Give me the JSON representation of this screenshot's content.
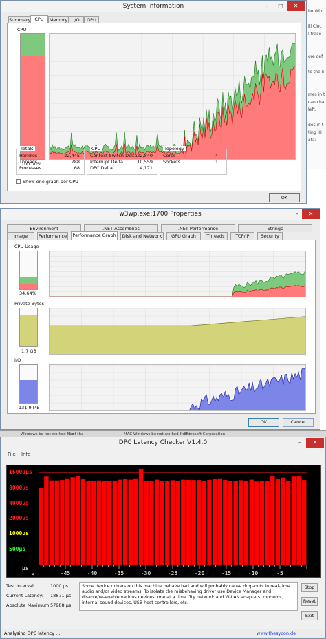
{
  "background_window": {
    "text_lines": [
      "hould c",
      "",
      "ill Cloc",
      "I trace",
      "",
      "",
      "ore def",
      "",
      "to the li",
      "",
      "",
      "mes in t",
      "can cha",
      "left.",
      "",
      "des in t",
      "ting 'H",
      "ata:"
    ],
    "taskbar_items": [
      "Windows be not worked fine",
      "",
      "1 of the",
      "",
      "",
      "MAC Windows be not worked freeti",
      "Microsoft Corporation"
    ]
  },
  "sysinfo": {
    "title": "System Information",
    "tabs": [
      "Summary",
      "CPU",
      "Memory",
      "I/O",
      "GPU"
    ],
    "active_tab": 1,
    "meter_label": "CPU",
    "meter_value": "100.00%",
    "meter_fraction_red": 0.82,
    "meter_fraction_total": 1.0,
    "totals": {
      "title": "Totals",
      "rows": [
        {
          "label": "Handles",
          "value": "22,445"
        },
        {
          "label": "Threads",
          "value": "788"
        },
        {
          "label": "Processes",
          "value": "68"
        }
      ]
    },
    "cpu_group": {
      "title": "CPU",
      "rows": [
        {
          "label": "Context Switch Delta",
          "value": "22,840"
        },
        {
          "label": "Interrupt Delta",
          "value": "10,559"
        },
        {
          "label": "DPC Delta",
          "value": "4,171"
        }
      ]
    },
    "topology": {
      "title": "Topology",
      "rows": [
        {
          "label": "Cores",
          "value": "4"
        },
        {
          "label": "Sockets",
          "value": "1"
        }
      ]
    },
    "checkbox_label": "Show one graph per CPU",
    "ok_label": "OK"
  },
  "w3wp": {
    "title": "w3wp.exe:1700 Properties",
    "tabs_row1": [
      "Environment",
      ".NET Assemblies",
      ".NET Performance",
      "Strings"
    ],
    "tabs_row2": [
      "Image",
      "Performance",
      "Performance Graph",
      "Disk and Network",
      "GPU Graph",
      "Threads",
      "TCP/IP",
      "Security"
    ],
    "active_tab_row2": 2,
    "cpu": {
      "label": "CPU Usage",
      "value": "34.64%",
      "fraction_red": 0.15,
      "fraction_total": 0.32
    },
    "private_bytes": {
      "label": "Private Bytes",
      "value": "1.7 GB",
      "fraction": 0.82
    },
    "io": {
      "label": "I/O",
      "value": "131.9 MB",
      "fraction": 0.6
    },
    "ok_label": "OK",
    "cancel_label": "Cancel"
  },
  "dpc": {
    "title": "DPC Latency Checker V1.4.0",
    "menu": [
      "File",
      "Info"
    ],
    "y_labels": [
      {
        "text": "16000µs",
        "color": "#ff2020"
      },
      {
        "text": "8000µs",
        "color": "#ff2020"
      },
      {
        "text": "4000µs",
        "color": "#ff2020"
      },
      {
        "text": "2000µs",
        "color": "#ff2020"
      },
      {
        "text": "1000µs",
        "color": "#ffff00"
      },
      {
        "text": "500µs",
        "color": "#33ff33"
      }
    ],
    "unit_labels": [
      "µs",
      "s"
    ],
    "x_labels": [
      "-45",
      "-40",
      "-35",
      "-30",
      "-25",
      "-20",
      "-15",
      "-10",
      "-5"
    ],
    "latency_values": [
      8000,
      13300,
      11200,
      11200,
      11400,
      12300,
      12900,
      13600,
      11800,
      11100,
      11100,
      11200,
      10900,
      11000,
      11100,
      11600,
      11800,
      11600,
      12300,
      18900,
      10800,
      11100,
      11600,
      10900,
      11000,
      11300,
      11100,
      11600,
      11500,
      11400,
      11400,
      11000,
      11500,
      11800,
      12300,
      11500,
      10800,
      10900,
      11300,
      11100,
      11600,
      10700,
      10800,
      10800,
      13600,
      12000,
      12700,
      10900,
      13300,
      13600,
      11400
    ],
    "info": [
      {
        "label": "Test Interval:",
        "value": "1000 µs"
      },
      {
        "label": "Current Latency:",
        "value": "18871 µs"
      },
      {
        "label": "Absolute Maximum:",
        "value": "57988 µs"
      }
    ],
    "message": "Some device drivers on this machine behave bad and will probably cause drop-outs in real-time audio and/or video streams. To isolate the misbehaving driver use Device Manager and disable/re-enable various devices, one at a time. Try network and W-LAN adapters, modems, internal sound devices, USB host controllers, etc.",
    "buttons": [
      "Stop",
      "Reset",
      "Exit"
    ],
    "status": "Analysing DPC latency ...",
    "link": "www.thesycon.de"
  },
  "colors": {
    "cpu_kernel_red": "#ff7b7b",
    "cpu_user_green": "#7fc97f",
    "line_red": "#c00000",
    "line_green": "#1c7a1c",
    "private_bytes_olive": "#d3d37a",
    "io_blue": "#7b86e8",
    "dpc_bar_red": "#ff0000"
  }
}
